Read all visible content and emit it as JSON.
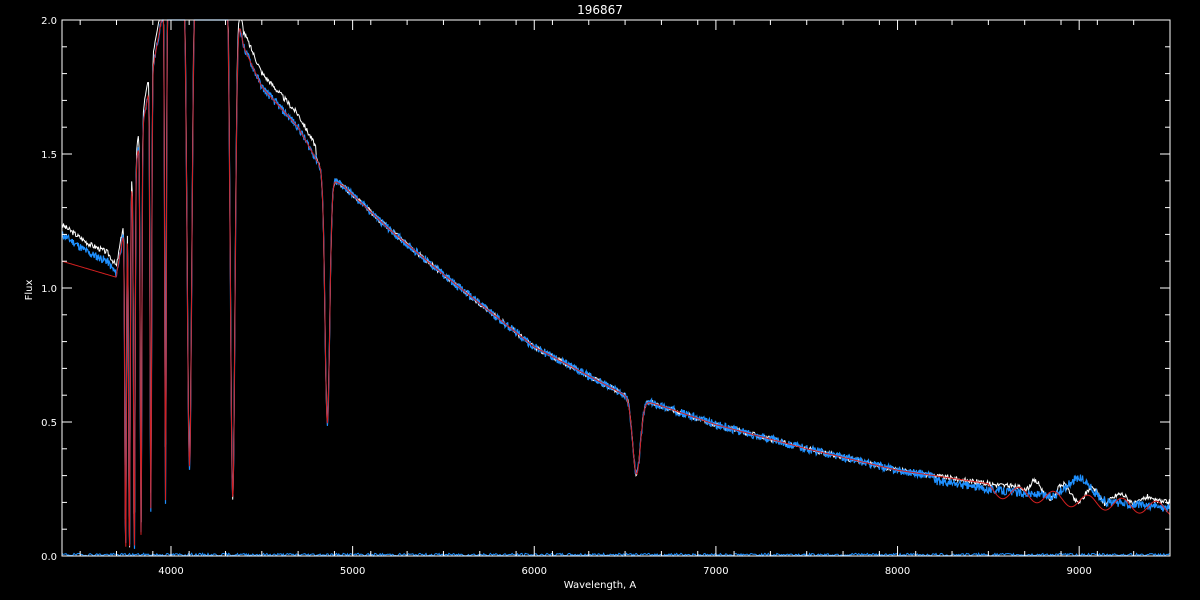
{
  "chart_data": {
    "type": "line",
    "title": "196867",
    "xlabel": "Wavelength, A",
    "ylabel": "Flux",
    "xlim": [
      3400,
      9500
    ],
    "ylim": [
      0.0,
      2.0
    ],
    "x_ticks": [
      4000,
      5000,
      6000,
      7000,
      8000,
      9000
    ],
    "x_tick_labels": [
      "4000",
      "5000",
      "6000",
      "7000",
      "8000",
      "9000"
    ],
    "y_ticks": [
      0.0,
      0.5,
      1.0,
      1.5,
      2.0
    ],
    "y_tick_labels": [
      "0.0",
      "0.5",
      "1.0",
      "1.5",
      "2.0"
    ],
    "grid": false,
    "colors": {
      "background": "#000000",
      "axes": "#ffffff",
      "white_series": "#ffffff",
      "blue_series": "#1e90ff",
      "red_series": "#d42020"
    },
    "continuum": {
      "x": [
        3400,
        3550,
        3650,
        3700,
        3750,
        4000,
        4300,
        4400,
        4500,
        4700,
        4850,
        4950,
        5200,
        5500,
        6000,
        6500,
        6700,
        7000,
        7500,
        8000,
        8500,
        9000,
        9500
      ],
      "y": [
        1.2,
        1.13,
        1.1,
        1.05,
        1.25,
        2.2,
        2.3,
        1.9,
        1.75,
        1.6,
        1.42,
        1.38,
        1.22,
        1.05,
        0.78,
        0.6,
        0.56,
        0.49,
        0.4,
        0.32,
        0.27,
        0.23,
        0.2
      ]
    },
    "absorption_lines": [
      {
        "x": 3750,
        "depth": 1.0
      },
      {
        "x": 3771,
        "depth": 1.0
      },
      {
        "x": 3798,
        "depth": 1.0
      },
      {
        "x": 3835,
        "depth": 0.95
      },
      {
        "x": 3889,
        "depth": 0.9
      },
      {
        "x": 3970,
        "depth": 0.9
      },
      {
        "x": 4102,
        "depth": 0.85
      },
      {
        "x": 4340,
        "depth": 0.9
      },
      {
        "x": 4861,
        "depth": 0.65
      },
      {
        "x": 6563,
        "depth": 0.48
      }
    ],
    "series": [
      {
        "color": "#ffffff",
        "values": "observed continuum with absorption, slightly above model in blue at 3400-4800"
      },
      {
        "color": "#1e90ff",
        "values": "observed spectrum with noise and telluric bands near 8900-9100"
      },
      {
        "color": "#d42020",
        "values": "model spectrum"
      }
    ],
    "blue_features": [
      {
        "x": 8950,
        "y": 0.35
      },
      {
        "x": 9050,
        "y": 0.33
      },
      {
        "x": 9300,
        "y": 0.18
      }
    ],
    "blue_noise_series": [
      {
        "x": 3400,
        "y": 0.01
      },
      {
        "x": 9500,
        "y": 0.0
      }
    ]
  }
}
